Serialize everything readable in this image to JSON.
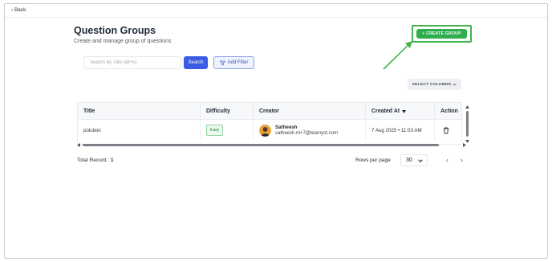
{
  "nav": {
    "back_label": "‹ Back"
  },
  "header": {
    "title": "Question Groups",
    "subtitle": "Create and manage group of questions"
  },
  "actions": {
    "create_group_icon": "plus-icon",
    "create_group_label": "+ CREATE GROUP"
  },
  "toolbar": {
    "search_placeholder": "Search by Title (alt+k)",
    "search_value": "",
    "search_button": "Search",
    "filter_icon": "funnel-icon",
    "filter_label": "Add Filter",
    "select_columns_label": "SELECT COLUMNS"
  },
  "table": {
    "columns": [
      "Title",
      "Difficulty",
      "Creator",
      "Created At",
      "Action"
    ],
    "sorted_column": "Created At",
    "sort_direction": "descending",
    "rows": [
      {
        "title": "polution",
        "difficulty": "Easy",
        "creator_name": "Satheesh",
        "creator_email": "satheesh.m+7@learnyst.com",
        "created_at": "7 Aug 2025 • 11:03 AM",
        "action_icon": "trash-icon"
      }
    ]
  },
  "footer": {
    "total_label": "Total Record : ",
    "total_value": "1",
    "rows_per_page_label": "Rows per page",
    "rows_per_page_value": "30"
  },
  "colors": {
    "create_button": "#2eae4e",
    "highlight_box": "#3fb44a",
    "search_button": "#3b5ce4",
    "filter_button_border": "#8aa0e8",
    "difficulty_easy": "#2d7a3c"
  }
}
